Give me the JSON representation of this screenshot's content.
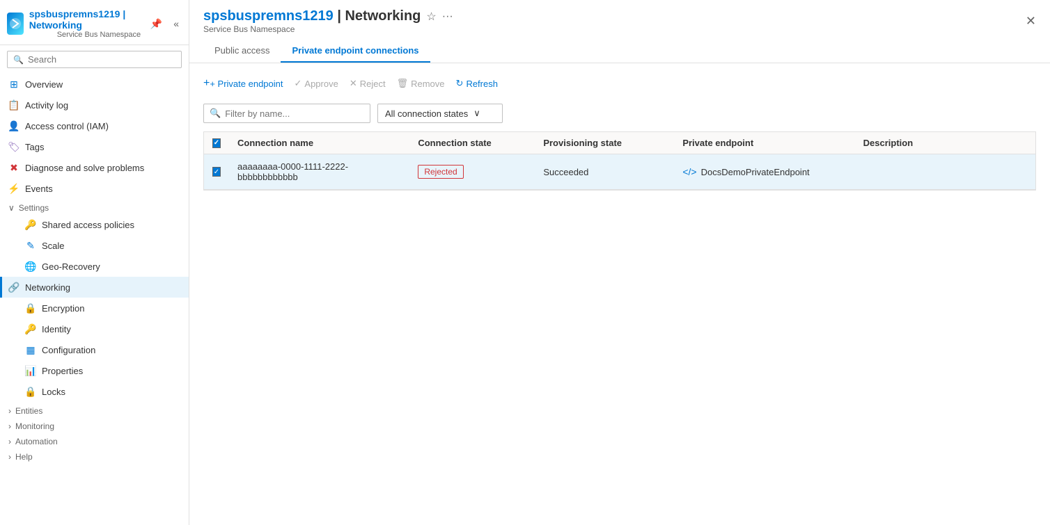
{
  "app": {
    "icon": "⚡",
    "title": "spsbuspremns1219 | Networking",
    "title_part1": "spsbuspremns1219",
    "title_separator": " | ",
    "title_part2": "Networking",
    "subtitle": "Service Bus Namespace"
  },
  "search": {
    "placeholder": "Search"
  },
  "nav": {
    "overview": "Overview",
    "activity_log": "Activity log",
    "access_control": "Access control (IAM)",
    "tags": "Tags",
    "diagnose": "Diagnose and solve problems",
    "events": "Events",
    "settings": "Settings",
    "shared_access": "Shared access policies",
    "scale": "Scale",
    "geo_recovery": "Geo-Recovery",
    "networking": "Networking",
    "encryption": "Encryption",
    "identity": "Identity",
    "configuration": "Configuration",
    "properties": "Properties",
    "locks": "Locks",
    "entities": "Entities",
    "monitoring": "Monitoring",
    "automation": "Automation",
    "help": "Help"
  },
  "tabs": {
    "public_access": "Public access",
    "private_endpoint": "Private endpoint connections"
  },
  "toolbar": {
    "add_endpoint": "+ Private endpoint",
    "approve": "Approve",
    "reject": "Reject",
    "remove": "Remove",
    "refresh": "Refresh"
  },
  "filter": {
    "placeholder": "Filter by name...",
    "dropdown_default": "All connection states"
  },
  "table": {
    "headers": {
      "connection_name": "Connection name",
      "connection_state": "Connection state",
      "provisioning_state": "Provisioning state",
      "private_endpoint": "Private endpoint",
      "description": "Description"
    },
    "rows": [
      {
        "name": "aaaaaaaa-0000-1111-2222-bbbbbbbbbbbb",
        "connection_state": "Rejected",
        "provisioning_state": "Succeeded",
        "private_endpoint": "DocsDemoPrivateEndpoint",
        "description": ""
      }
    ]
  }
}
